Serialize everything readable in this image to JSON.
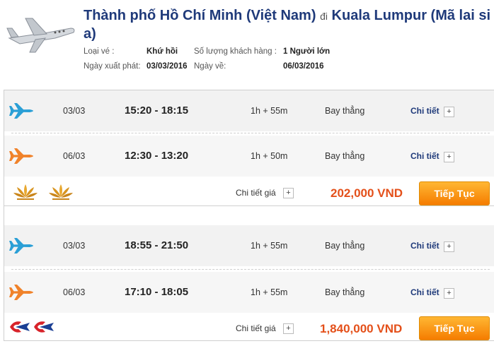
{
  "header": {
    "route_from": "Thành phố Hồ Chí Minh (Việt Nam)",
    "route_di": "đi",
    "route_to": "Kuala Lumpur (Mã lai si a)",
    "ticket_type_label": "Loại vé :",
    "ticket_type_value": "Khứ hồi",
    "passengers_label": "Số lượng khách hàng :",
    "passengers_value": "1 Người lớn",
    "depart_label": "Ngày xuất phát:",
    "depart_value": "03/03/2016",
    "return_label": "Ngày về:",
    "return_value": "06/03/2016"
  },
  "results": [
    {
      "outbound": {
        "date": "03/03",
        "time": "15:20 - 18:15",
        "duration": "1h + 55m",
        "type": "Bay thẳng",
        "detail": "Chi tiết"
      },
      "inbound": {
        "date": "06/03",
        "time": "12:30 - 13:20",
        "duration": "1h + 50m",
        "type": "Bay thẳng",
        "detail": "Chi tiết"
      },
      "airline_icon": "vietnam-airlines-lotus-logo",
      "price_detail": "Chi tiết giá",
      "price": "202,000 VND",
      "button": "Tiếp Tục"
    },
    {
      "outbound": {
        "date": "03/03",
        "time": "18:55 - 21:50",
        "duration": "1h + 55m",
        "type": "Bay thẳng",
        "detail": "Chi tiết"
      },
      "inbound": {
        "date": "06/03",
        "time": "17:10 - 18:05",
        "duration": "1h + 55m",
        "type": "Bay thẳng",
        "detail": "Chi tiết"
      },
      "airline_icon": "malaysia-airlines-logo",
      "price_detail": "Chi tiết giá",
      "price": "1,840,000 VND",
      "button": "Tiếp Tục"
    }
  ],
  "plus_symbol": "+",
  "colors": {
    "title": "#1f3a7a",
    "price": "#e4501a",
    "button": "#f57c00",
    "outbound_plane": "#2a9fd6",
    "inbound_plane": "#f0822a"
  }
}
